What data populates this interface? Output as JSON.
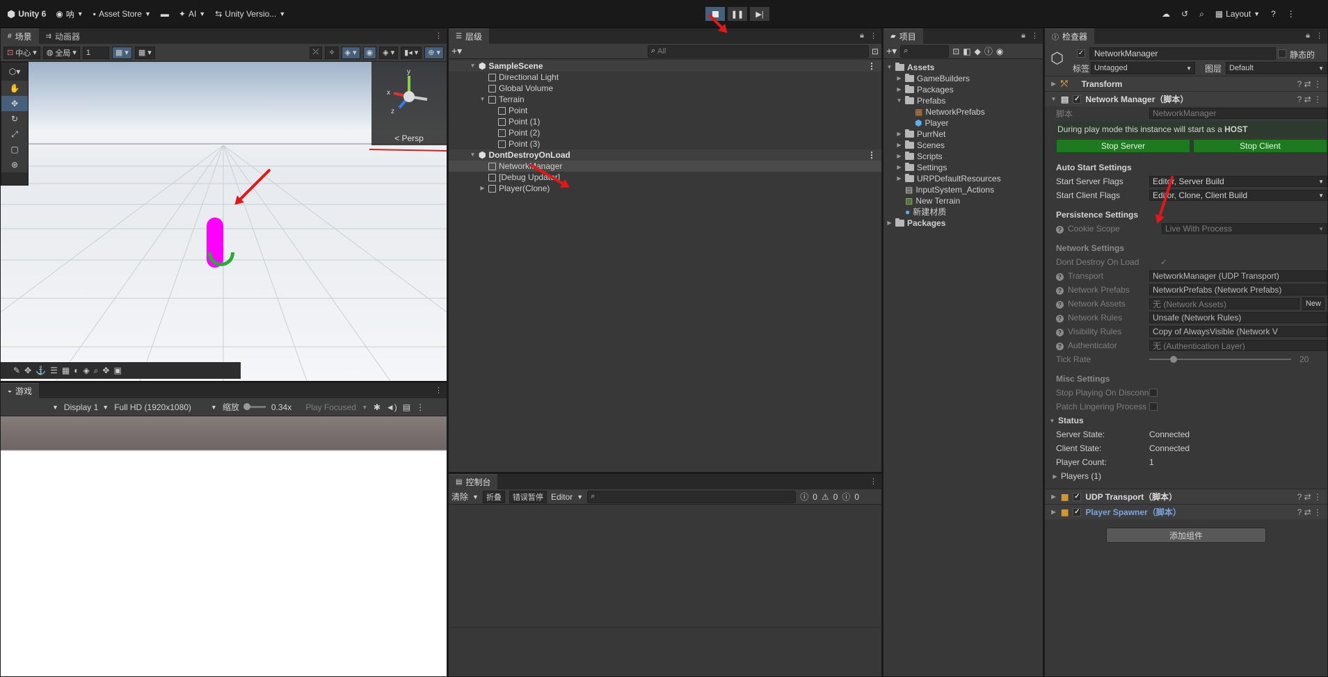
{
  "topbar": {
    "logo_label": "Unity 6",
    "account_label": "呐",
    "asset_store_label": "Asset Store",
    "ai_label": "AI",
    "version_control_label": "Unity Versio...",
    "layout_label": "Layout"
  },
  "scene_panel": {
    "tabs": [
      "场景",
      "动画器"
    ],
    "pivot_label": "中心",
    "space_label": "全局",
    "grid_value": "1",
    "persp_label": "< Persp",
    "gizmo_axes": {
      "x": "x",
      "y": "y",
      "z": "z"
    }
  },
  "game_panel": {
    "tab_label": "游戏",
    "display_label": "Display 1",
    "resolution_label": "Full HD (1920x1080)",
    "scale_label": "缩放",
    "scale_value": "0.34x",
    "play_focused_label": "Play Focused"
  },
  "hierarchy_panel": {
    "tab_label": "层级",
    "search_placeholder": "All",
    "items": [
      {
        "label": "SampleScene",
        "kind": "scene",
        "depth": 0
      },
      {
        "label": "Directional Light",
        "kind": "object",
        "depth": 1
      },
      {
        "label": "Global Volume",
        "kind": "object",
        "depth": 1
      },
      {
        "label": "Terrain",
        "kind": "object",
        "depth": 1
      },
      {
        "label": "Point",
        "kind": "object",
        "depth": 2
      },
      {
        "label": "Point (1)",
        "kind": "object",
        "depth": 2
      },
      {
        "label": "Point (2)",
        "kind": "object",
        "depth": 2
      },
      {
        "label": "Point (3)",
        "kind": "object",
        "depth": 2
      },
      {
        "label": "DontDestroyOnLoad",
        "kind": "scene",
        "depth": 0
      },
      {
        "label": "NetworkManager",
        "kind": "object",
        "depth": 1
      },
      {
        "label": "[Debug Updater]",
        "kind": "object",
        "depth": 1
      },
      {
        "label": "Player(Clone)",
        "kind": "object",
        "depth": 1
      }
    ]
  },
  "console_panel": {
    "tab_label": "控制台",
    "clear_label": "清除",
    "collapse_label": "折叠",
    "error_pause_label": "错误暂停",
    "editor_label": "Editor",
    "log_count": "0",
    "warning_count": "0",
    "error_count": "0"
  },
  "project_panel": {
    "tab_label": "项目",
    "tree": [
      {
        "label": "Assets",
        "depth": 0
      },
      {
        "label": "GameBuilders",
        "depth": 1
      },
      {
        "label": "Packages",
        "depth": 1
      },
      {
        "label": "Prefabs",
        "depth": 1
      },
      {
        "label": "NetworkPrefabs",
        "depth": 2
      },
      {
        "label": "Player",
        "depth": 2
      },
      {
        "label": "PurrNet",
        "depth": 1
      },
      {
        "label": "Scenes",
        "depth": 1
      },
      {
        "label": "Scripts",
        "depth": 1
      },
      {
        "label": "Settings",
        "depth": 1
      },
      {
        "label": "URPDefaultResources",
        "depth": 1
      },
      {
        "label": "InputSystem_Actions",
        "depth": 1
      },
      {
        "label": "New Terrain",
        "depth": 1
      },
      {
        "label": "新建材质",
        "depth": 1
      },
      {
        "label": "Packages",
        "depth": 0
      }
    ]
  },
  "inspector_panel": {
    "tab_label": "检查器",
    "object_name": "NetworkManager",
    "static_label": "静态的",
    "tag_label": "标签",
    "tag_value": "Untagged",
    "layer_label": "图层",
    "layer_value": "Default",
    "transform_label": "Transform",
    "network_manager_label": "Network Manager（脚本）",
    "script_label": "脚本",
    "script_value": "NetworkManager",
    "host_info": "During play mode this instance will start as a ",
    "host_word": "HOST",
    "stop_server_label": "Stop Server",
    "stop_client_label": "Stop Client",
    "auto_start_header": "Auto Start Settings",
    "start_server_flags_label": "Start Server Flags",
    "start_server_flags_value": "Editor, Server Build",
    "start_client_flags_label": "Start Client Flags",
    "start_client_flags_value": "Editor, Clone, Client Build",
    "persistence_header": "Persistence Settings",
    "cookie_scope_label": "Cookie Scope",
    "cookie_scope_value": "Live With Process",
    "network_settings_header": "Network Settings",
    "dont_destroy_label": "Dont Destroy On Load",
    "transport_label": "Transport",
    "transport_value": "NetworkManager (UDP Transport)",
    "network_prefabs_label": "Network Prefabs",
    "network_prefabs_value": "NetworkPrefabs (Network Prefabs)",
    "network_assets_label": "Network Assets",
    "network_assets_value": "无 (Network Assets)",
    "new_button_label": "New",
    "network_rules_label": "Network Rules",
    "network_rules_value": "Unsafe (Network Rules)",
    "visibility_rules_label": "Visibility Rules",
    "visibility_rules_value": "Copy of AlwaysVisible (Network V",
    "authenticator_label": "Authenticator",
    "authenticator_value": "无 (Authentication Layer)",
    "tick_rate_label": "Tick Rate",
    "tick_rate_value": "20",
    "misc_header": "Misc Settings",
    "stop_playing_label": "Stop Playing On Disconnec",
    "patch_lingering_label": "Patch Lingering Process B",
    "status_header": "Status",
    "server_state_label": "Server State:",
    "server_state_value": "Connected",
    "client_state_label": "Client State:",
    "client_state_value": "Connected",
    "player_count_label": "Player Count:",
    "player_count_value": "1",
    "players_label": "Players (1)",
    "udp_transport_label": "UDP Transport（脚本）",
    "player_spawner_label": "Player Spawner（脚本）",
    "add_component_label": "添加组件"
  },
  "colors": {
    "accent_blue": "#46607c",
    "play_green": "#1e7a1e",
    "arrow_red": "#e01818",
    "capsule_magenta": "#ff00ff"
  }
}
